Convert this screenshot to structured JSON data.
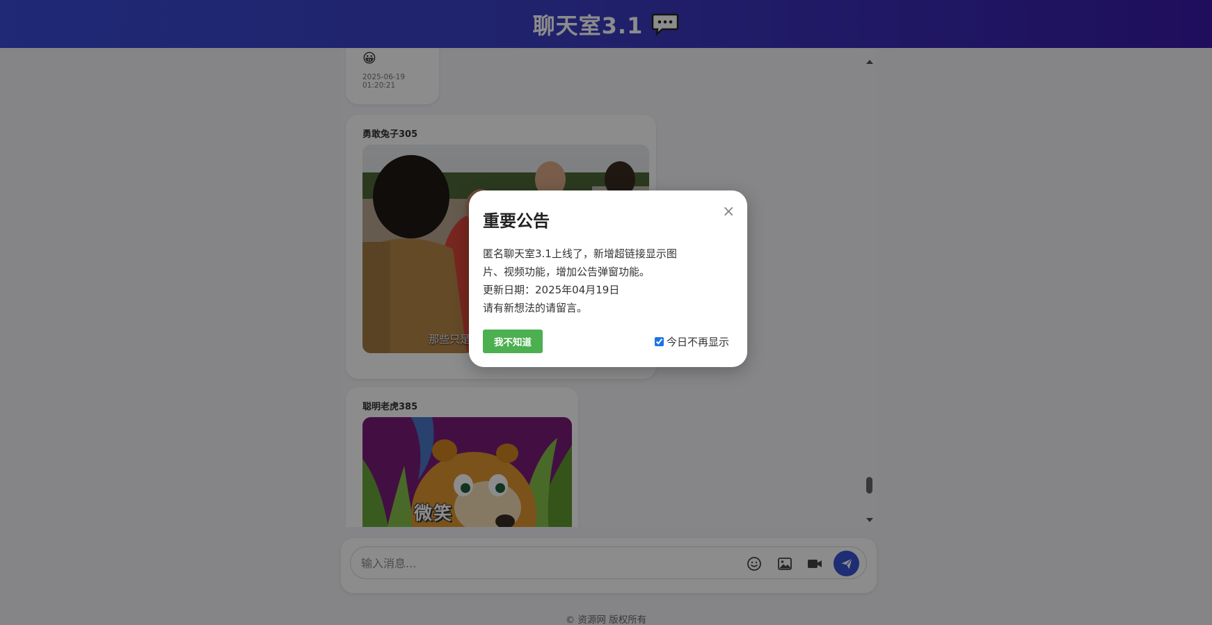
{
  "header": {
    "title": "聊天室3.1",
    "icon": "speech-bubble-icon"
  },
  "messages": [
    {
      "emoji": "😀",
      "time": "2025-06-19 01:20:21"
    },
    {
      "sender": "勇敢兔子305",
      "image": "movie-still",
      "caption": "那些只是"
    },
    {
      "sender": "聪明老虎385",
      "image": "cartoon-bear",
      "caption": "微笑"
    }
  ],
  "composer": {
    "placeholder": "输入消息...",
    "emoji_icon": "smile-icon",
    "image_icon": "image-icon",
    "video_icon": "video-camera-icon",
    "send_icon": "paper-plane-icon"
  },
  "footer": {
    "text": "© 资源网 版权所有"
  },
  "modal": {
    "title": "重要公告",
    "close": "×",
    "line1": "匿名聊天室3.1上线了，新增超链接显示图片、视频功能，增加公告弹窗功能。",
    "line2": "更新日期：2025年04月19日",
    "line3": "请有新想法的请留言。",
    "ack_label": "我不知道",
    "dont_show_label": "今日不再显示",
    "dont_show_checked": true
  },
  "colors": {
    "header_start": "#3a4bd6",
    "header_end": "#3a1aa8",
    "send": "#3a53d6",
    "ack": "#4caf50"
  }
}
